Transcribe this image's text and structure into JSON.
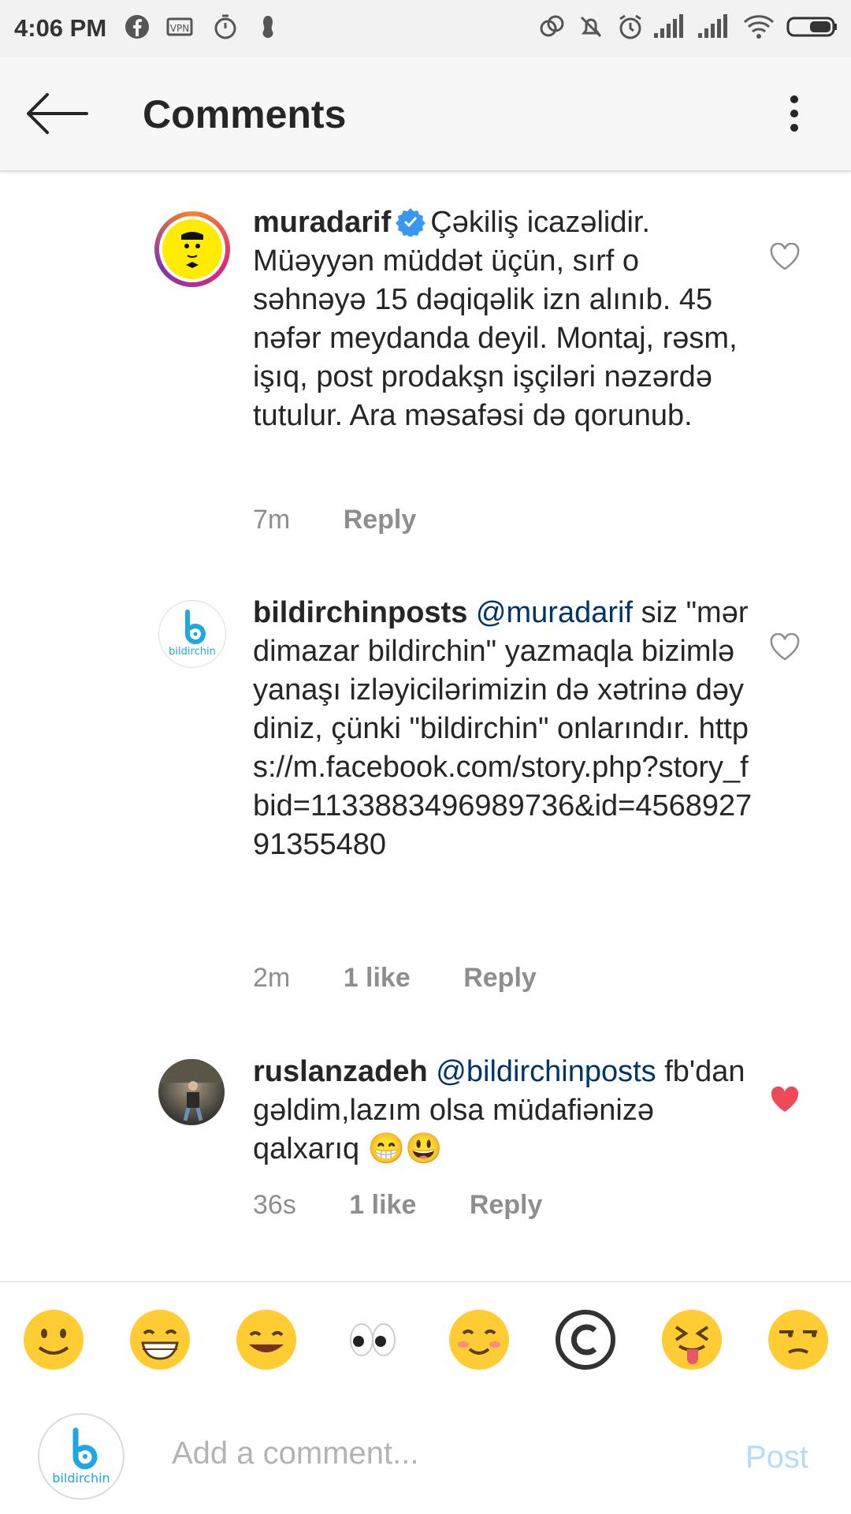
{
  "status_bar": {
    "time": "4:06 PM"
  },
  "header": {
    "title": "Comments"
  },
  "comments": [
    {
      "username": "muradarif",
      "verified": true,
      "mention": "",
      "text": "Çəkiliş icazəlidir. Müəyyən müddət üçün, sırf o səhnəyə 15 dəqiqəlik izn alınıb.  45 nəfər meydanda deyil. Montaj, rəsm, işıq, post prodakşn işçiləri nəzərdə tutulur. Ara məsafəsi də qorunub.",
      "time": "7m",
      "likes": "",
      "reply": "Reply",
      "liked": false
    },
    {
      "username": "bildirchinposts",
      "verified": false,
      "mention": "@muradarif",
      "text": "siz \"mərdimazar bildirchin\" yazmaqla bizimlə yanaşı izləyicilərimizin də xətrinə dəydiniz, çünki \"bildirchin\" onlarındır.   https://m.facebook.com/story.php?story_fbid=1133883496989736&id=456892791355480",
      "time": "2m",
      "likes": "1 like",
      "reply": "Reply",
      "liked": false
    },
    {
      "username": "ruslanzadeh",
      "verified": false,
      "mention": "@bildirchinposts",
      "text": "fb'dan gəldim,lazım olsa müdafiənizə qalxarıq 😁😃",
      "time": "36s",
      "likes": "1 like",
      "reply": "Reply",
      "liked": true
    }
  ],
  "avatars": {
    "bildirchin_logo_text": "bildirchin"
  },
  "emoji_bar": [
    "🙂",
    "😁",
    "😊",
    "👀",
    "😊",
    "©",
    "😝",
    "😒"
  ],
  "input": {
    "placeholder": "Add a comment...",
    "post_label": "Post"
  },
  "colors": {
    "accent": "#3897f0",
    "heart_red": "#ed4956",
    "mention": "#003569",
    "post_disabled": "#b3dbff"
  }
}
